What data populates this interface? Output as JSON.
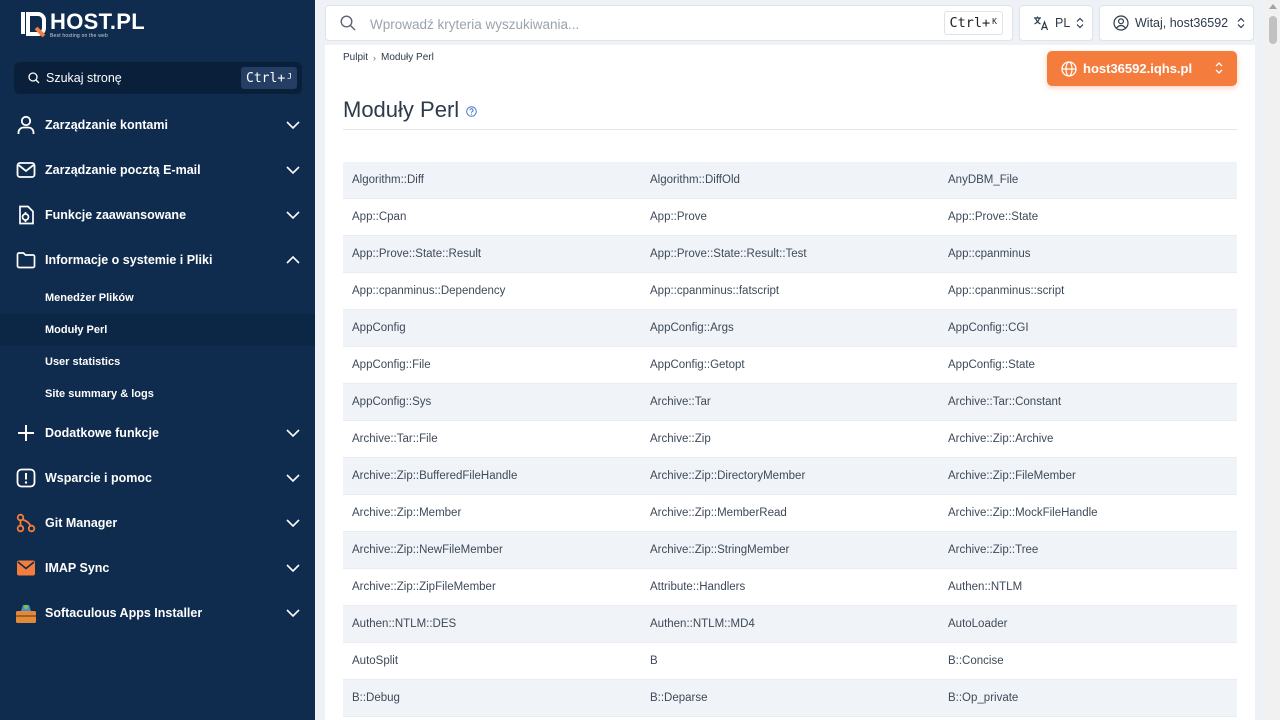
{
  "brand": {
    "name": "HOST.PL",
    "tagline": "Best hosting on the web"
  },
  "sidebar": {
    "search": {
      "label": "Szukaj stronę",
      "shortcut_main": "Ctrl+",
      "shortcut_key": "J"
    },
    "items": [
      {
        "label": "Zarządzanie kontami",
        "icon": "user-icon",
        "expanded": false
      },
      {
        "label": "Zarządzanie pocztą E-mail",
        "icon": "mail-icon",
        "expanded": false
      },
      {
        "label": "Funkcje zaawansowane",
        "icon": "advanced-settings-icon",
        "expanded": false
      },
      {
        "label": "Informacje o systemie i Pliki",
        "icon": "folder-icon",
        "expanded": true,
        "children": [
          {
            "label": "Menedżer Plików",
            "active": false
          },
          {
            "label": "Moduły Perl",
            "active": true
          },
          {
            "label": "User statistics",
            "active": false
          },
          {
            "label": "Site summary & logs",
            "active": false
          }
        ]
      },
      {
        "label": "Dodatkowe funkcje",
        "icon": "plus-icon",
        "expanded": false
      },
      {
        "label": "Wsparcie i pomoc",
        "icon": "alert-icon",
        "expanded": false
      },
      {
        "label": "Git Manager",
        "icon": "git-icon",
        "expanded": false
      },
      {
        "label": "IMAP Sync",
        "icon": "imap-mail-icon",
        "expanded": false
      },
      {
        "label": "Softaculous Apps Installer",
        "icon": "softaculous-icon",
        "expanded": false
      }
    ]
  },
  "header": {
    "search_placeholder": "Wprowadź kryteria wyszukiwania...",
    "shortcut_main": "Ctrl+",
    "shortcut_key": "K",
    "language": "PL",
    "user_greeting": "Witaj, host36592"
  },
  "breadcrumb": [
    "Pulpit",
    "Moduły Perl"
  ],
  "domain": "host36592.iqhs.pl",
  "page_title": "Moduły Perl",
  "colors": {
    "sidebar_bg": "#0f2b4d",
    "accent": "#f47c3c"
  },
  "modules": [
    [
      "Algorithm::Diff",
      "Algorithm::DiffOld",
      "AnyDBM_File"
    ],
    [
      "App::Cpan",
      "App::Prove",
      "App::Prove::State"
    ],
    [
      "App::Prove::State::Result",
      "App::Prove::State::Result::Test",
      "App::cpanminus"
    ],
    [
      "App::cpanminus::Dependency",
      "App::cpanminus::fatscript",
      "App::cpanminus::script"
    ],
    [
      "AppConfig",
      "AppConfig::Args",
      "AppConfig::CGI"
    ],
    [
      "AppConfig::File",
      "AppConfig::Getopt",
      "AppConfig::State"
    ],
    [
      "AppConfig::Sys",
      "Archive::Tar",
      "Archive::Tar::Constant"
    ],
    [
      "Archive::Tar::File",
      "Archive::Zip",
      "Archive::Zip::Archive"
    ],
    [
      "Archive::Zip::BufferedFileHandle",
      "Archive::Zip::DirectoryMember",
      "Archive::Zip::FileMember"
    ],
    [
      "Archive::Zip::Member",
      "Archive::Zip::MemberRead",
      "Archive::Zip::MockFileHandle"
    ],
    [
      "Archive::Zip::NewFileMember",
      "Archive::Zip::StringMember",
      "Archive::Zip::Tree"
    ],
    [
      "Archive::Zip::ZipFileMember",
      "Attribute::Handlers",
      "Authen::NTLM"
    ],
    [
      "Authen::NTLM::DES",
      "Authen::NTLM::MD4",
      "AutoLoader"
    ],
    [
      "AutoSplit",
      "B",
      "B::Concise"
    ],
    [
      "B::Debug",
      "B::Deparse",
      "B::Op_private"
    ]
  ]
}
